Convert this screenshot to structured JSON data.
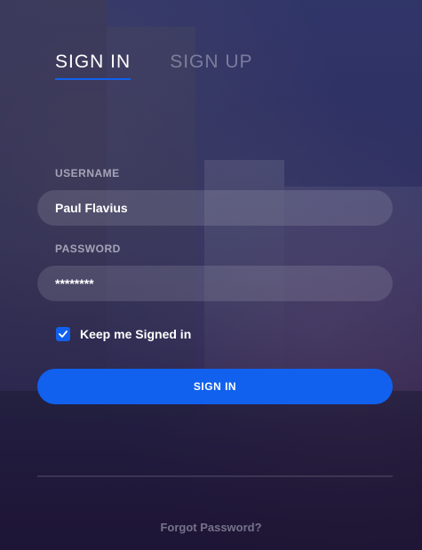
{
  "tabs": {
    "sign_in": "SIGN IN",
    "sign_up": "SIGN UP"
  },
  "form": {
    "username_label": "USERNAME",
    "username_value": "Paul Flavius",
    "password_label": "PASSWORD",
    "password_value": "********",
    "keep_signed_in_label": "Keep me Signed in",
    "keep_signed_in_checked": true,
    "submit_label": "SIGN IN"
  },
  "footer": {
    "forgot_password": "Forgot Password?"
  },
  "colors": {
    "accent": "#1161ee",
    "text": "#ffffff"
  },
  "icons": {
    "checkbox": "check-icon"
  }
}
